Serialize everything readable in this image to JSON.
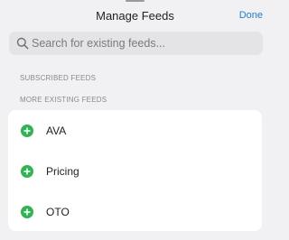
{
  "header": {
    "title": "Manage Feeds",
    "done_label": "Done"
  },
  "search": {
    "placeholder": "Search for existing feeds...",
    "value": "",
    "icon": "search-icon"
  },
  "sections": {
    "subscribed_label": "SUBSCRIBED FEEDS",
    "more_label": "MORE EXISTING FEEDS"
  },
  "feeds": [
    {
      "label": "AVA",
      "icon": "add-circle-icon"
    },
    {
      "label": "Pricing",
      "icon": "add-circle-icon"
    },
    {
      "label": "OTO",
      "icon": "add-circle-icon"
    }
  ],
  "colors": {
    "accent": "#1b7fd8",
    "add_green": "#2db552",
    "background": "#f1f1f3"
  }
}
